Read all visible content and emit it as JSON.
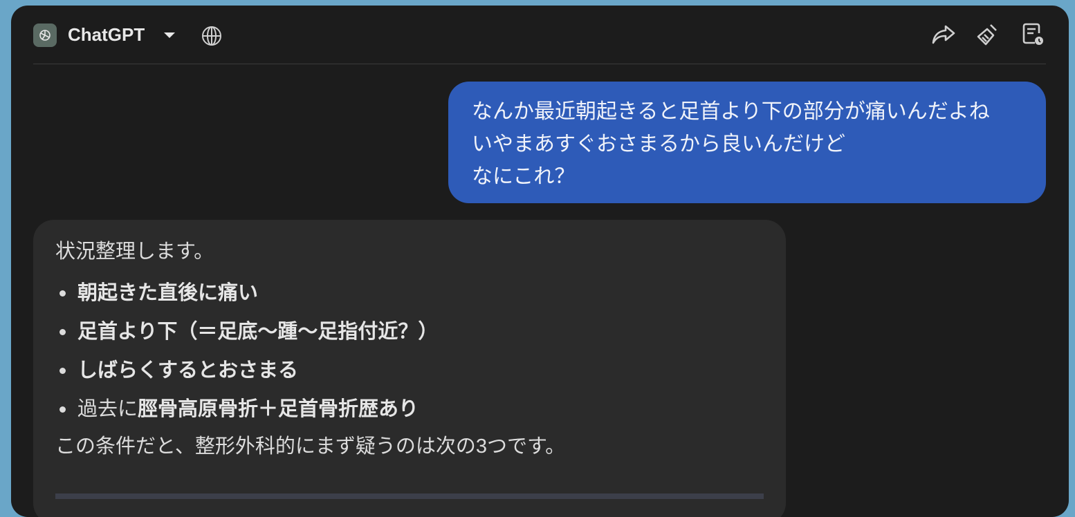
{
  "header": {
    "app_title": "ChatGPT",
    "icons": {
      "logo": "chatgpt-logo-icon",
      "caret": "chevron-down-icon",
      "globe": "globe-icon",
      "share": "share-icon",
      "clear": "broom-icon",
      "notes": "document-clock-icon"
    }
  },
  "conversation": {
    "user_message": {
      "lines": [
        "なんか最近朝起きると足首より下の部分が痛いんだよね",
        "いやまあすぐおさまるから良いんだけど",
        "なにこれ？"
      ]
    },
    "assistant_message": {
      "intro": "状況整理します。",
      "bullets": [
        {
          "normal": "",
          "bold": "朝起きた直後に痛い"
        },
        {
          "normal": "",
          "bold": "足首より下（＝足底〜踵〜足指付近？）"
        },
        {
          "normal": "",
          "bold": "しばらくするとおさまる"
        },
        {
          "normal": "過去に",
          "bold": "脛骨高原骨折＋足首骨折歴あり"
        }
      ],
      "outro": "この条件だと、整形外科的にまず疑うのは次の3つです。"
    }
  },
  "colors": {
    "background": "#6aa6c8",
    "window": "#1c1c1c",
    "user_bubble": "#2e5bb8",
    "assistant_bubble": "#2b2b2b"
  }
}
